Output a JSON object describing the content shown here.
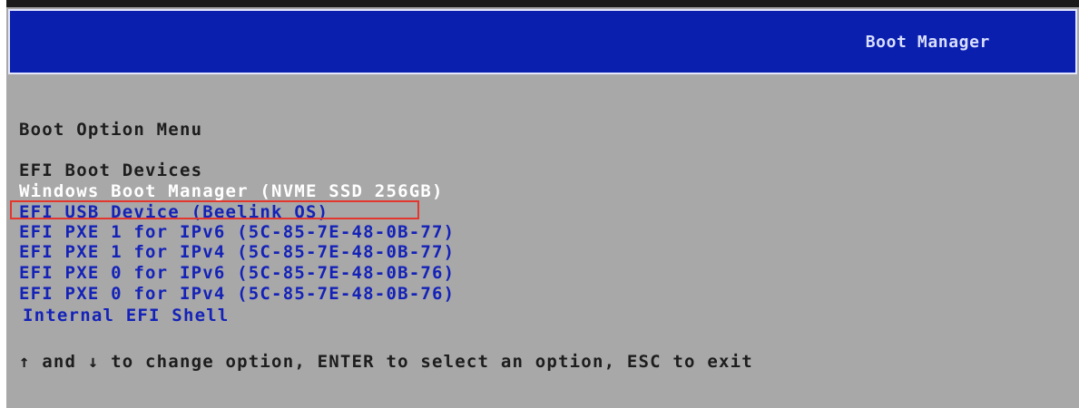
{
  "header": {
    "title": "Boot Manager"
  },
  "menu": {
    "title": "Boot Option Menu",
    "group_title": "EFI Boot Devices",
    "options": [
      {
        "label": "Windows Boot Manager (NVME SSD 256GB)"
      },
      {
        "label": "EFI USB Device (Beelink OS)"
      },
      {
        "label": "EFI PXE 1 for IPv6 (5C-85-7E-48-0B-77)"
      },
      {
        "label": "EFI PXE 1 for IPv4 (5C-85-7E-48-0B-77)"
      },
      {
        "label": "EFI PXE 0 for IPv6 (5C-85-7E-48-0B-76)"
      },
      {
        "label": "EFI PXE 0 for IPv4 (5C-85-7E-48-0B-76)"
      },
      {
        "label": "Internal EFI Shell"
      }
    ]
  },
  "footer": {
    "hint": "↑ and ↓ to change option, ENTER to select an option, ESC to exit"
  },
  "colors": {
    "background": "#a8a8a8",
    "header_bar": "#0b1fae",
    "option_text": "#1422b8",
    "selected_text": "#ffffff",
    "highlight_box": "#e3362d"
  }
}
